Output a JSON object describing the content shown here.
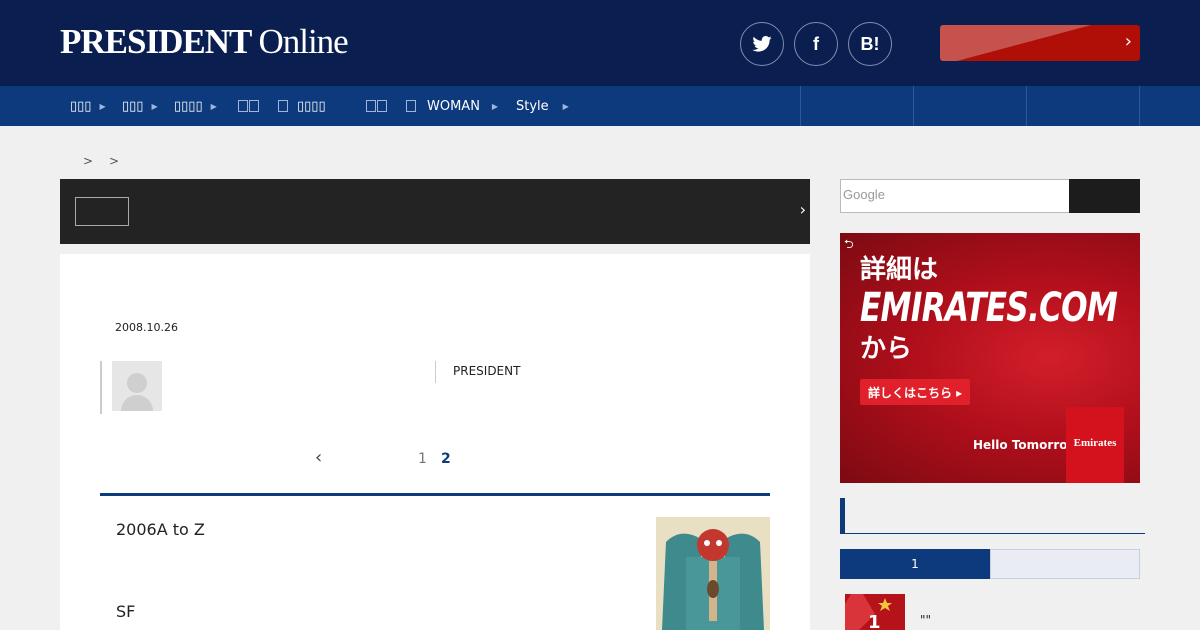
{
  "header": {
    "logo_main": "PRESIDENT",
    "logo_online": "Online",
    "social": {
      "twitter": "",
      "facebook": "f",
      "hatena": "B!"
    },
    "subscribe_label": ""
  },
  "nav": {
    "items": [
      {
        "label": "▯▯▯"
      },
      {
        "label": "▯▯▯"
      },
      {
        "label": "▯▯▯▯"
      },
      {
        "label": ""
      },
      {
        "label": "▯▯▯▯"
      },
      {
        "label": ""
      },
      {
        "label": "WOMAN"
      },
      {
        "label": "Style"
      }
    ]
  },
  "breadcrumb": {
    "sep1": ">",
    "sep2": ">"
  },
  "banner": {
    "label": ""
  },
  "article": {
    "date": "2008.10.26",
    "publisher": "PRESIDENT",
    "pager": {
      "page1": "1",
      "page2": "2"
    },
    "line1": "2006A to Z",
    "line2": "SF"
  },
  "sidebar": {
    "search_placeholder": "Google",
    "ad": {
      "line1": "詳細は",
      "line2": "EMIRATES.COM",
      "line3": "から",
      "cta": "詳しくはこちら ▸",
      "tagline": "Hello Tomorrow",
      "brand": "Emirates"
    },
    "tab_active": "1",
    "ranking": [
      {
        "rank": "1",
        "title": "\"\""
      }
    ]
  },
  "colors": {
    "navy": "#0a1e4f",
    "nav_blue": "#0d3a7c",
    "accent_red": "#b00f08"
  }
}
